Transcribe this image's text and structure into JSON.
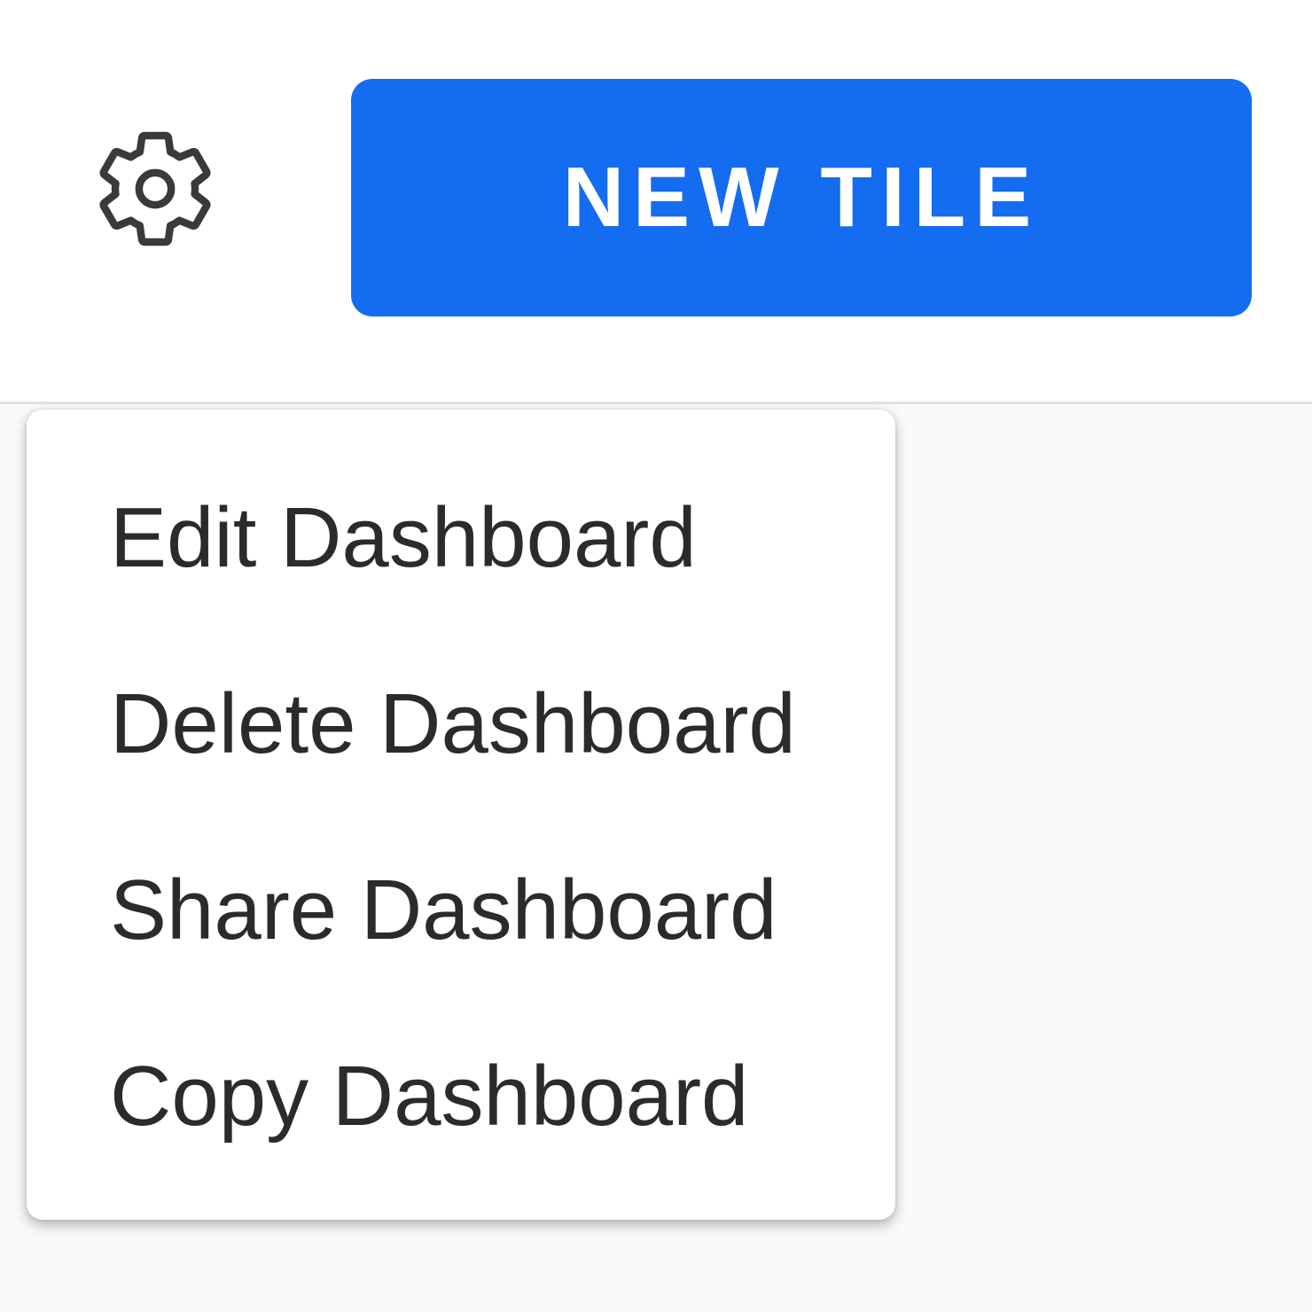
{
  "toolbar": {
    "settings_icon": "gear-icon",
    "new_tile_label": "NEW TILE"
  },
  "settings_menu": {
    "items": [
      {
        "label": "Edit Dashboard"
      },
      {
        "label": "Delete Dashboard"
      },
      {
        "label": "Share Dashboard"
      },
      {
        "label": "Copy Dashboard"
      }
    ]
  },
  "colors": {
    "primary": "#146cf0",
    "page_background": "#f9f9f9",
    "surface": "#ffffff",
    "text": "#2b2b2b",
    "icon": "#3a3a3a"
  }
}
